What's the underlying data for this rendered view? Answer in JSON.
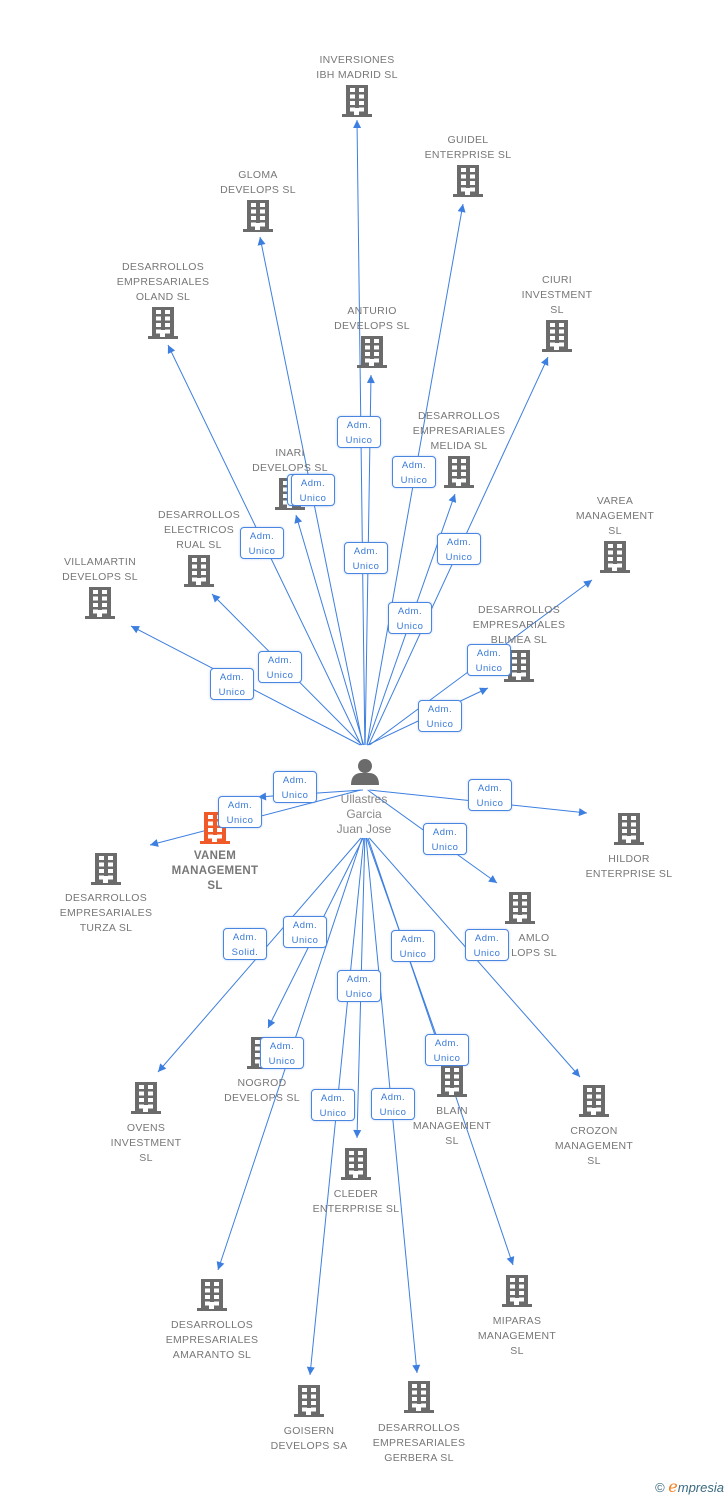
{
  "center": {
    "name_lines": [
      "Ullastres",
      "Garcia",
      "Juan Jose"
    ],
    "icon": "person-icon"
  },
  "colors": {
    "edge": "#3d7fe0",
    "building": "#6b6b6b",
    "highlight": "#f05a28"
  },
  "nodes": [
    {
      "lines": [
        "INVERSIONES",
        "IBH MADRID  SL"
      ],
      "role": [
        "Adm.",
        "Unico"
      ]
    },
    {
      "lines": [
        "GUIDEL",
        "ENTERPRISE  SL"
      ],
      "role": [
        "Adm.",
        "Unico"
      ]
    },
    {
      "lines": [
        "GLOMA",
        "DEVELOPS  SL"
      ],
      "role": [
        "Adm.",
        "Unico"
      ]
    },
    {
      "lines": [
        "DESARROLLOS",
        "EMPRESARIALES",
        "OLAND  SL"
      ],
      "role": [
        "Adm.",
        "Unico"
      ]
    },
    {
      "lines": [
        "ANTURIO",
        "DEVELOPS SL"
      ],
      "role": [
        "Adm.",
        "Unico"
      ]
    },
    {
      "lines": [
        "CIURI",
        "INVESTMENT",
        "SL"
      ],
      "role": [
        "Adm.",
        "Unico"
      ]
    },
    {
      "lines": [
        "DESARROLLOS",
        "EMPRESARIALES",
        "MELIDA  SL"
      ],
      "role": [
        "Adm.",
        "Unico"
      ]
    },
    {
      "lines": [
        "INARI",
        "DEVELOPS  SL"
      ],
      "role": [
        "Adm.",
        "Unico"
      ]
    },
    {
      "lines": [
        "VAREA",
        "MANAGEMENT",
        "SL"
      ],
      "role": [
        "Adm.",
        "Unico"
      ]
    },
    {
      "lines": [
        "DESARROLLOS",
        "ELECTRICOS",
        "RUAL  SL"
      ],
      "role": [
        "Adm.",
        "Unico"
      ]
    },
    {
      "lines": [
        "VILLAMARTIN",
        "DEVELOPS SL"
      ],
      "role": [
        "Adm.",
        "Unico"
      ]
    },
    {
      "lines": [
        "DESARROLLOS",
        "EMPRESARIALES",
        "BLIMEA  SL"
      ],
      "role": [
        "Adm.",
        "Unico"
      ]
    },
    {
      "lines": [
        "HILDOR",
        "ENTERPRISE SL"
      ],
      "role": [
        "Adm.",
        "Unico"
      ]
    },
    {
      "lines": [
        "VANEM",
        "MANAGEMENT",
        "SL"
      ],
      "role": [
        "Adm.",
        "Unico"
      ],
      "main": true
    },
    {
      "lines": [
        "DESARROLLOS",
        "EMPRESARIALES",
        "TURZA  SL"
      ],
      "role": [
        "Adm.",
        "Unico"
      ]
    },
    {
      "lines": [
        "AMLO",
        "LOPS  SL"
      ],
      "role": [
        "Adm.",
        "Unico"
      ]
    },
    {
      "lines": [
        "OVENS",
        "INVESTMENT",
        "SL"
      ],
      "role": [
        "Adm.",
        "Solid."
      ]
    },
    {
      "lines": [
        "NOGROD",
        "DEVELOPS SL"
      ],
      "role": [
        "Adm.",
        "Unico"
      ]
    },
    {
      "lines": [
        "CROZON",
        "MANAGEMENT",
        "SL"
      ],
      "role": [
        "Adm.",
        "Unico"
      ]
    },
    {
      "lines": [
        "BLAIN",
        "MANAGEMENT",
        "SL"
      ],
      "role": [
        "Adm.",
        "Unico"
      ]
    },
    {
      "lines": [
        "CLEDER",
        "ENTERPRISE  SL"
      ],
      "role": [
        "Adm.",
        "Unico"
      ]
    },
    {
      "lines": [
        "DESARROLLOS",
        "EMPRESARIALES",
        "AMARANTO SL"
      ],
      "role": [
        "Adm.",
        "Unico"
      ]
    },
    {
      "lines": [
        "MIPARAS",
        "MANAGEMENT",
        "SL"
      ],
      "role": [
        "Adm.",
        "Unico"
      ]
    },
    {
      "lines": [
        "GOISERN",
        "DEVELOPS SA"
      ],
      "role": [
        "Adm.",
        "Unico"
      ]
    },
    {
      "lines": [
        "DESARROLLOS",
        "EMPRESARIALES",
        "GERBERA  SL"
      ],
      "role": [
        "Adm.",
        "Unico"
      ]
    }
  ],
  "footer": {
    "copyright": "©",
    "brand_e": "e",
    "brand_rest": "mpresia"
  }
}
